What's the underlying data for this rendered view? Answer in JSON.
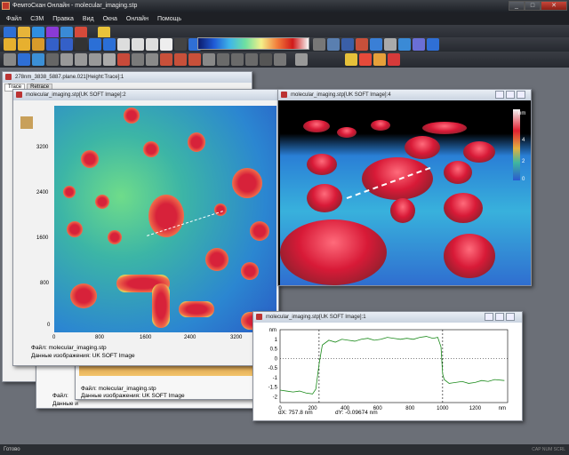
{
  "app": {
    "title": "ФемтоСкан Онлайн - molecular_imaging.stp",
    "controls": [
      "_",
      "□",
      "✕"
    ]
  },
  "menu": [
    "Файл",
    "СЗМ",
    "Правка",
    "Вид",
    "Окна",
    "Онлайн",
    "Помощь"
  ],
  "status": {
    "text": "Готово",
    "right": "CAP NUM SCRL"
  },
  "back_window": {
    "title": "278nm_3838_5887.plane.021[Height:Trace]:1",
    "tabs": [
      "Trace",
      "Retrace"
    ]
  },
  "window2d": {
    "title": "molecular_imaging.stp[UK SOFT Image]:2",
    "y_ticks": [
      "3200",
      "2400",
      "1600",
      "800",
      "0"
    ],
    "x_ticks": [
      "0",
      "800",
      "1600",
      "2400",
      "3200"
    ],
    "file_label": "Файл: molecular_imaging.stp",
    "data_label": "Данные изображения: UK SOFT Image"
  },
  "lower_window": {
    "file_label": "Файл: molecular_imaging.stp",
    "data_label": "Данные изображения: UK SOFT Image",
    "file_label_short": "Файл:",
    "data_label_short": "Данные и"
  },
  "window3d": {
    "title": "molecular_imaging.stp[UK SOFT Image]:4",
    "scale_unit": "nm",
    "scale_ticks": [
      "4",
      "2",
      "0"
    ]
  },
  "profile": {
    "title": "molecular_imaging.stp[UK SOFT Image]:1",
    "y_unit": "nm",
    "x_unit": "nm",
    "dx": "dX: 757.8 nm",
    "dy": "dY: -0.09674 nm",
    "color": "#1a8a1a"
  },
  "chart_data": {
    "type": "line",
    "title": "",
    "xlabel": "nm",
    "ylabel": "nm",
    "xlim": [
      0,
      1400
    ],
    "ylim": [
      -2.3,
      1.5
    ],
    "x_ticks": [
      0,
      200,
      400,
      600,
      800,
      1000,
      1200
    ],
    "y_ticks": [
      1,
      0.5,
      0,
      -0.5,
      -1,
      -1.5,
      -2
    ],
    "cursors_x": [
      240,
      1000
    ],
    "series": [
      {
        "x": [
          0,
          40,
          80,
          120,
          160,
          200,
          220,
          240,
          260,
          300,
          340,
          380,
          420,
          460,
          500,
          540,
          580,
          620,
          660,
          700,
          740,
          780,
          820,
          860,
          900,
          940,
          970,
          990,
          1000,
          1010,
          1040,
          1080,
          1120,
          1160,
          1200,
          1240,
          1280,
          1320,
          1380
        ],
        "y": [
          -1.65,
          -1.7,
          -1.75,
          -1.7,
          -1.8,
          -1.85,
          -1.6,
          -0.3,
          0.7,
          0.95,
          0.85,
          1.0,
          0.95,
          0.9,
          1.0,
          1.05,
          0.95,
          1.0,
          1.1,
          1.05,
          1.0,
          1.05,
          1.0,
          1.1,
          1.15,
          1.05,
          1.1,
          0.6,
          -0.8,
          -1.1,
          -1.3,
          -1.25,
          -1.2,
          -1.3,
          -1.25,
          -1.15,
          -1.2,
          -1.1,
          -1.15
        ]
      }
    ]
  }
}
